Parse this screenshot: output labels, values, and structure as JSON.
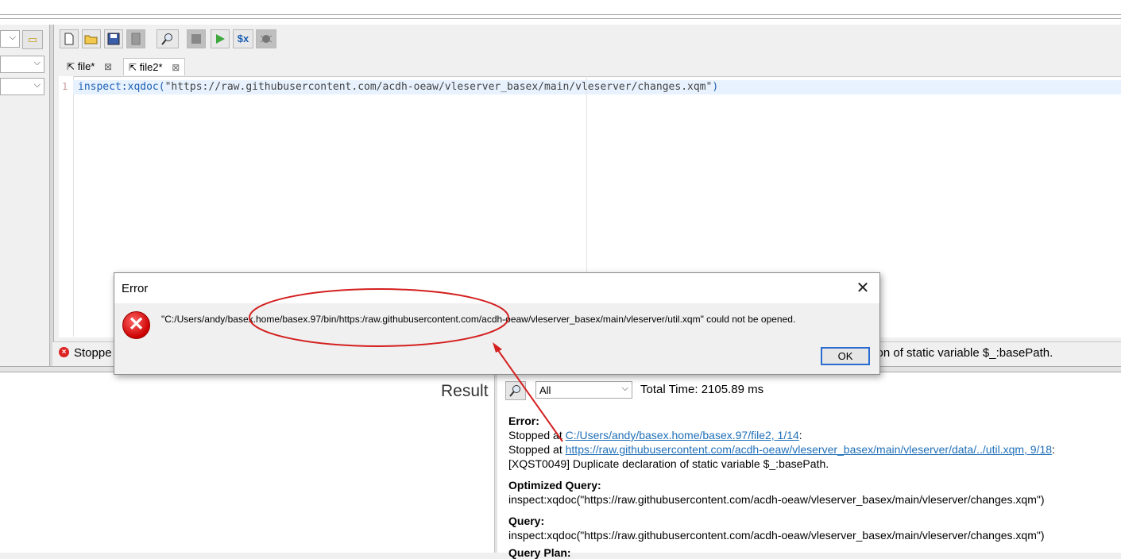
{
  "editor": {
    "tabs": [
      {
        "label": "file*"
      },
      {
        "label": "file2*"
      }
    ],
    "line_number": "1",
    "code_fn": "inspect:xqdoc",
    "code_paren_open": "(",
    "code_string": "\"https://raw.githubusercontent.com/acdh-oeaw/vleserver_basex/main/vleserver/changes.xqm\"",
    "code_paren_close": ")"
  },
  "status": {
    "left_text": "Stoppe",
    "right_text": "tion of static variable $_:basePath."
  },
  "result_panel": {
    "title": "Result",
    "filter_value": "All",
    "total_time": "Total Time: 2105.89 ms",
    "error_heading": "Error:",
    "stopped_at_1_prefix": "Stopped at ",
    "stopped_at_1_link": "C:/Users/andy/basex.home/basex.97/file2, 1/14",
    "stopped_at_1_suffix": ":",
    "stopped_at_2_prefix": "Stopped at ",
    "stopped_at_2_link": "https://raw.githubusercontent.com/acdh-oeaw/vleserver_basex/main/vleserver/data/../util.xqm, 9/18",
    "stopped_at_2_suffix": ":",
    "error_message": "[XQST0049] Duplicate declaration of static variable $_:basePath.",
    "optimized_heading": "Optimized Query:",
    "optimized_query": "inspect:xqdoc(\"https://raw.githubusercontent.com/acdh-oeaw/vleserver_basex/main/vleserver/changes.xqm\")",
    "query_heading": "Query:",
    "query": "inspect:xqdoc(\"https://raw.githubusercontent.com/acdh-oeaw/vleserver_basex/main/vleserver/changes.xqm\")",
    "partial_next": "Query Plan:"
  },
  "dialog": {
    "title": "Error",
    "message": "\"C:/Users/andy/basex.home/basex.97/bin/https:/raw.githubusercontent.com/acdh-oeaw/vleserver_basex/main/vleserver/util.xqm\" could not be opened.",
    "ok_label": "OK",
    "close_glyph": "✕"
  },
  "icons": {
    "new": "new-file-icon",
    "open": "open-folder-icon",
    "save": "save-icon",
    "close": "close-file-icon",
    "find": "search-icon",
    "stop": "stop-icon",
    "run": "run-icon",
    "variables": "variables-icon",
    "debug": "debug-icon"
  },
  "toolbar": {
    "variables_label": "$x"
  },
  "colors": {
    "annotation": "#d42020",
    "link": "#1f6fb8",
    "keyword": "#1e60b4"
  }
}
